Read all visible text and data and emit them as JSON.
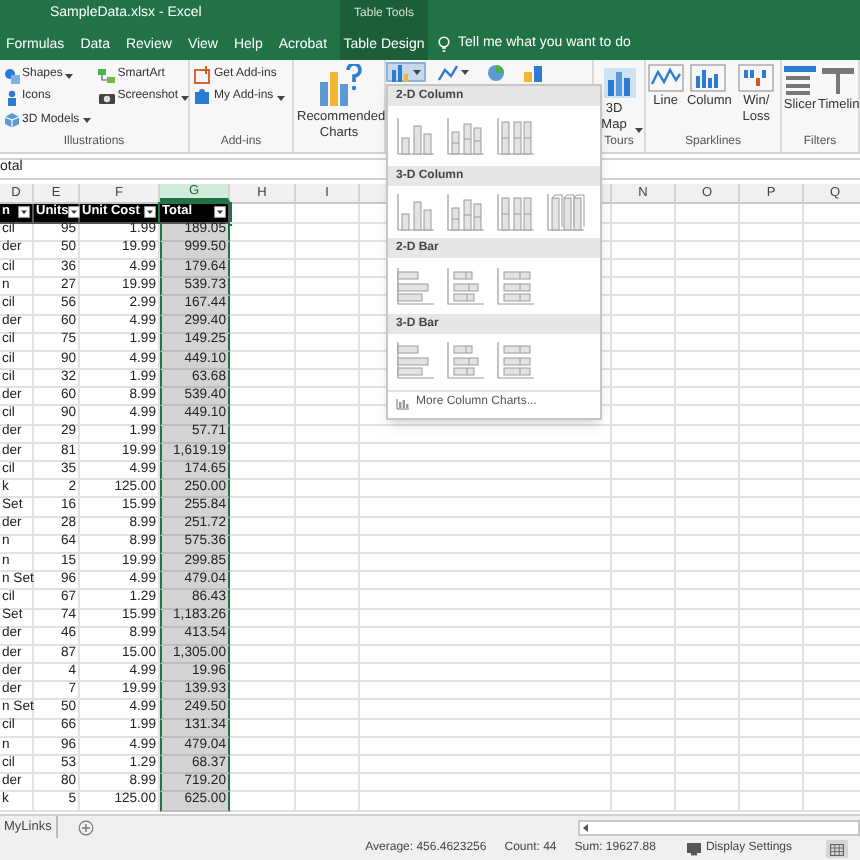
{
  "window": {
    "title": "SampleData.xlsx  -  Excel",
    "contextual_group": "Table Tools"
  },
  "tabs": [
    {
      "label": "Formulas",
      "kind": "normal"
    },
    {
      "label": "Data",
      "kind": "normal"
    },
    {
      "label": "Review",
      "kind": "normal"
    },
    {
      "label": "View",
      "kind": "normal"
    },
    {
      "label": "Help",
      "kind": "normal"
    },
    {
      "label": "Acrobat",
      "kind": "normal"
    },
    {
      "label": "Table Design",
      "kind": "contextual"
    }
  ],
  "tell_me": {
    "placeholder": "Tell me what you want to do"
  },
  "ribbon": {
    "groups": [
      {
        "kind": "small",
        "label": "Illustrations",
        "items": [
          {
            "label": "Shapes",
            "kind": "shapes",
            "dropdown": true
          },
          {
            "label": "Icons",
            "kind": "icons",
            "dropdown": false
          },
          {
            "label": "3D Models",
            "kind": "cube",
            "dropdown": true
          },
          {
            "label": "SmartArt",
            "kind": "smartart",
            "dropdown": false
          },
          {
            "label": "Screenshot",
            "kind": "camera",
            "dropdown": true
          }
        ]
      },
      {
        "kind": "small",
        "label": "Add-ins",
        "items": [
          {
            "label": "Get Add-ins",
            "kind": "store",
            "dropdown": false
          },
          {
            "label": "My Add-ins",
            "kind": "addins",
            "dropdown": true
          }
        ]
      },
      {
        "kind": "large",
        "items": [
          {
            "label": "Recommended Charts",
            "kind": "recommended",
            "dropdown": false
          }
        ]
      },
      {
        "kind": "icons",
        "items": [
          {
            "kind": "column",
            "dropdown": true,
            "selected": true
          },
          {
            "kind": "line",
            "dropdown": true,
            "selected": false
          },
          {
            "kind": "pie",
            "dropdown": false,
            "selected": false
          },
          {
            "kind": "bar",
            "dropdown": false,
            "selected": false
          }
        ]
      },
      {
        "kind": "large",
        "label": "Tours",
        "items": [
          {
            "label": "3D Map",
            "kind": "map",
            "dropdown": true
          }
        ]
      },
      {
        "kind": "large",
        "label": "Sparklines",
        "items": [
          {
            "label": "Line",
            "kind": "sparkline",
            "dropdown": false
          },
          {
            "label": "Column",
            "kind": "sparkcolumn",
            "dropdown": false
          },
          {
            "label": "Win/ Loss",
            "kind": "winloss",
            "dropdown": false
          }
        ]
      },
      {
        "kind": "large",
        "label": "Filters",
        "items": [
          {
            "label": "Slicer",
            "kind": "slicer",
            "dropdown": false
          },
          {
            "label": "Timelin",
            "kind": "timeline",
            "dropdown": false
          }
        ]
      }
    ]
  },
  "chart_menu": {
    "sections": [
      {
        "title": "2-D Column",
        "kind": "column",
        "options": [
          {
            "kind": "clustered"
          },
          {
            "kind": "stacked"
          },
          {
            "kind": "percent"
          }
        ]
      },
      {
        "title": "3-D Column",
        "kind": "column",
        "options": [
          {
            "kind": "clustered"
          },
          {
            "kind": "stacked"
          },
          {
            "kind": "percent"
          },
          {
            "kind": "depth"
          }
        ]
      },
      {
        "title": "2-D Bar",
        "kind": "bar",
        "options": [
          {
            "kind": "clustered"
          },
          {
            "kind": "stacked"
          },
          {
            "kind": "percent"
          }
        ]
      },
      {
        "title": "3-D Bar",
        "kind": "bar",
        "options": [
          {
            "kind": "clustered"
          },
          {
            "kind": "stacked"
          },
          {
            "kind": "percent"
          }
        ]
      }
    ],
    "more": "More Column Charts..."
  },
  "formula_bar": {
    "value": "otal"
  },
  "column_letters": [
    {
      "label": "D",
      "selected": false
    },
    {
      "label": "E",
      "selected": false
    },
    {
      "label": "F",
      "selected": false
    },
    {
      "label": "G",
      "selected": true
    },
    {
      "label": "H",
      "selected": false
    },
    {
      "label": "I",
      "selected": false
    },
    {
      "label": "N",
      "selected": false
    },
    {
      "label": "O",
      "selected": false
    },
    {
      "label": "P",
      "selected": false
    },
    {
      "label": "Q",
      "selected": false
    }
  ],
  "table": {
    "columns": [
      "n",
      "Units",
      "Unit Cost",
      "Total"
    ],
    "rows": [
      [
        "cil",
        "95",
        "1.99",
        "189.05"
      ],
      [
        "der",
        "50",
        "19.99",
        "999.50"
      ],
      [
        "cil",
        "36",
        "4.99",
        "179.64"
      ],
      [
        "n",
        "27",
        "19.99",
        "539.73"
      ],
      [
        "cil",
        "56",
        "2.99",
        "167.44"
      ],
      [
        "der",
        "60",
        "4.99",
        "299.40"
      ],
      [
        "cil",
        "75",
        "1.99",
        "149.25"
      ],
      [
        "cil",
        "90",
        "4.99",
        "449.10"
      ],
      [
        "cil",
        "32",
        "1.99",
        "63.68"
      ],
      [
        "der",
        "60",
        "8.99",
        "539.40"
      ],
      [
        "cil",
        "90",
        "4.99",
        "449.10"
      ],
      [
        "der",
        "29",
        "1.99",
        "57.71"
      ],
      [
        "der",
        "81",
        "19.99",
        "1,619.19"
      ],
      [
        "cil",
        "35",
        "4.99",
        "174.65"
      ],
      [
        "k",
        "2",
        "125.00",
        "250.00"
      ],
      [
        "Set",
        "16",
        "15.99",
        "255.84"
      ],
      [
        "der",
        "28",
        "8.99",
        "251.72"
      ],
      [
        "n",
        "64",
        "8.99",
        "575.36"
      ],
      [
        "n",
        "15",
        "19.99",
        "299.85"
      ],
      [
        "n Set",
        "96",
        "4.99",
        "479.04"
      ],
      [
        "cil",
        "67",
        "1.29",
        "86.43"
      ],
      [
        "Set",
        "74",
        "15.99",
        "1,183.26"
      ],
      [
        "der",
        "46",
        "8.99",
        "413.54"
      ],
      [
        "der",
        "87",
        "15.00",
        "1,305.00"
      ],
      [
        "der",
        "4",
        "4.99",
        "19.96"
      ],
      [
        "der",
        "7",
        "19.99",
        "139.93"
      ],
      [
        "n Set",
        "50",
        "4.99",
        "249.50"
      ],
      [
        "cil",
        "66",
        "1.99",
        "131.34"
      ],
      [
        "n",
        "96",
        "4.99",
        "479.04"
      ],
      [
        "cil",
        "53",
        "1.29",
        "68.37"
      ],
      [
        "der",
        "80",
        "8.99",
        "719.20"
      ],
      [
        "k",
        "5",
        "125.00",
        "625.00"
      ]
    ]
  },
  "sheet_tabs": [
    {
      "label": "MyLinks"
    }
  ],
  "status_bar": {
    "items": [
      "Average: 456.4623256",
      "Count: 44",
      "Sum: 19627.88"
    ],
    "display_settings": "Display Settings"
  }
}
